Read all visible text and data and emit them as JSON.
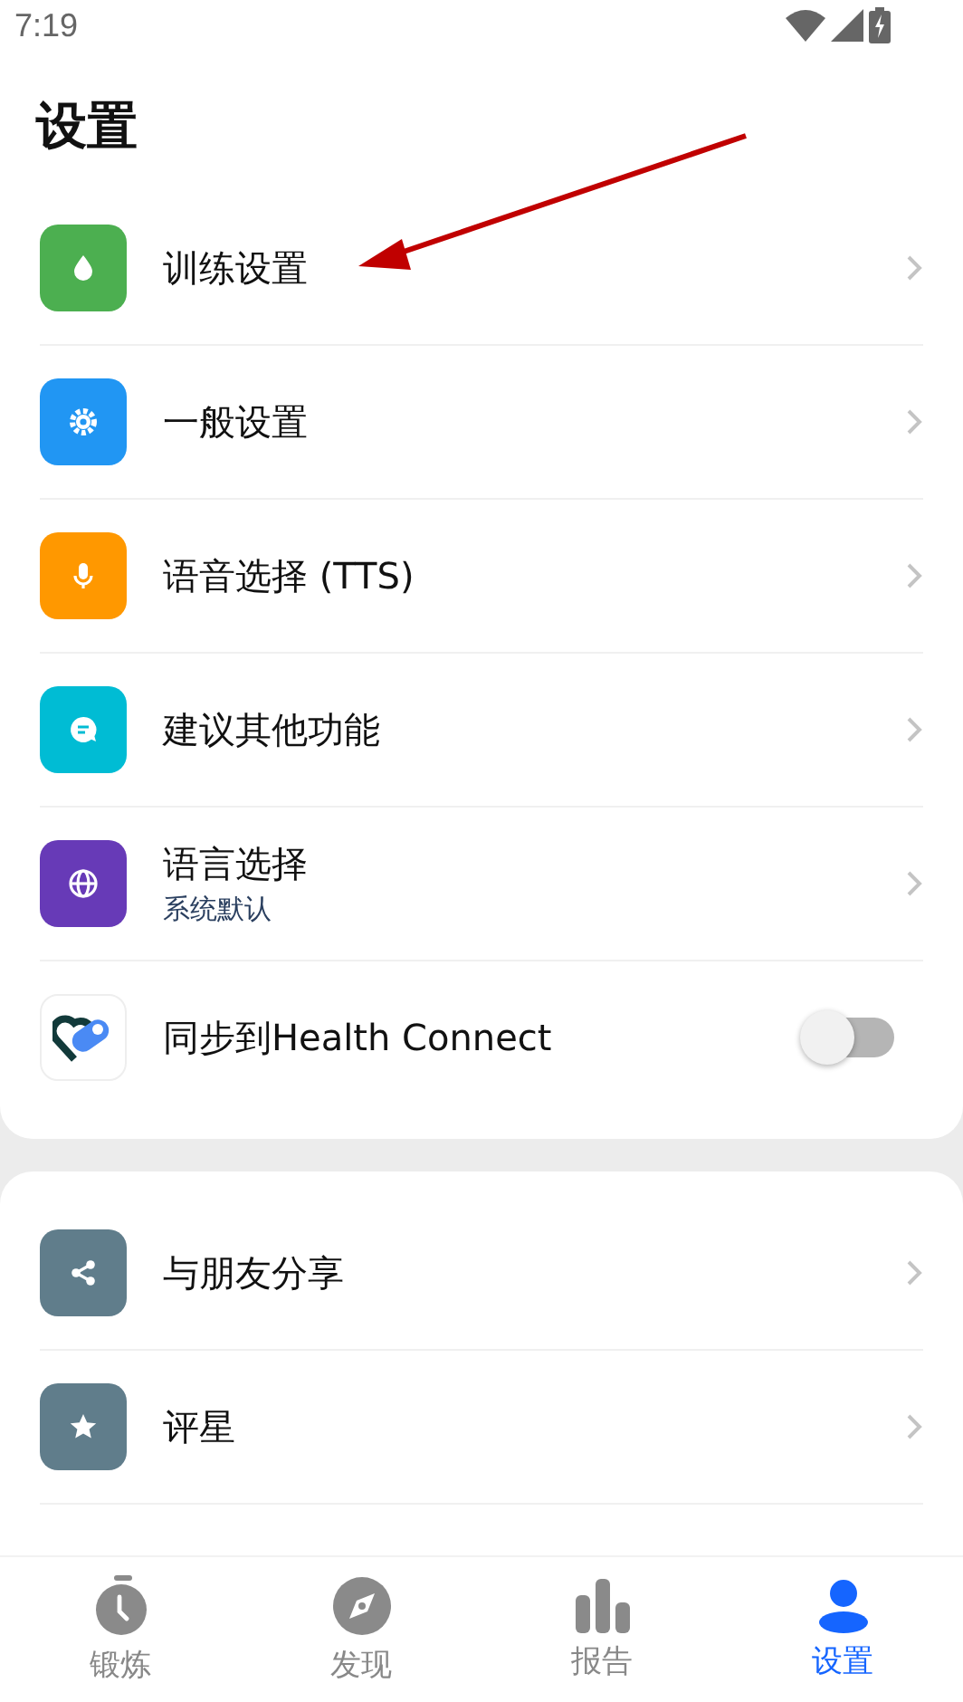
{
  "status_bar": {
    "time": "7:19"
  },
  "title": "设置",
  "main_list": [
    {
      "kind": "link",
      "color": "#4caf50",
      "label": "训练设置"
    },
    {
      "kind": "link",
      "color": "#2196f3",
      "label": "一般设置"
    },
    {
      "kind": "link",
      "color": "#ff9800",
      "label": "语音选择 (TTS)"
    },
    {
      "kind": "link",
      "color": "#00bcd4",
      "label": "建议其他功能"
    },
    {
      "kind": "link",
      "color": "#673ab7",
      "label": "语言选择",
      "subtitle": "系统默认"
    },
    {
      "kind": "toggle",
      "label": "同步到Health Connect",
      "on": false
    }
  ],
  "more_list": [
    {
      "kind": "link",
      "color": "#607d8b",
      "label": "与朋友分享"
    },
    {
      "kind": "link",
      "color": "#607d8b",
      "label": "评星"
    }
  ],
  "bottom_nav": [
    {
      "label": "锻炼",
      "selected": false
    },
    {
      "label": "发现",
      "selected": false
    },
    {
      "label": "报告",
      "selected": false
    },
    {
      "label": "设置",
      "selected": true
    }
  ]
}
